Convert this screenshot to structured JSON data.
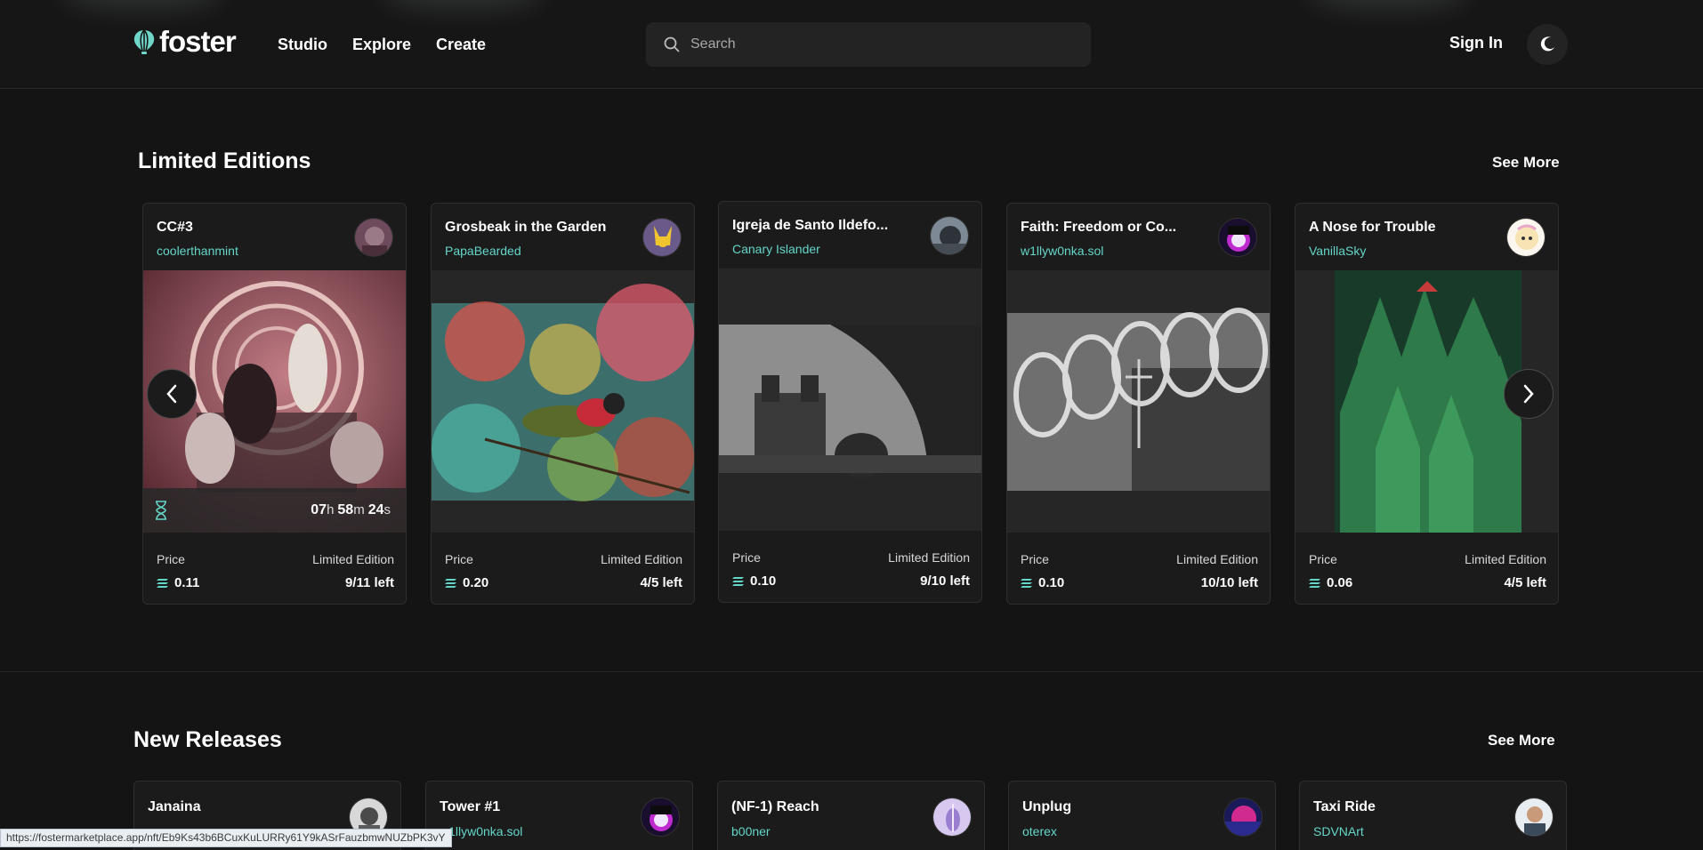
{
  "header": {
    "logo_text": "foster",
    "nav": [
      {
        "label": "Studio"
      },
      {
        "label": "Explore"
      },
      {
        "label": "Create"
      }
    ],
    "search_placeholder": "Search",
    "sign_in": "Sign In"
  },
  "limited_editions": {
    "title": "Limited Editions",
    "see_more": "See More",
    "price_label": "Price",
    "edition_label": "Limited Edition",
    "cards": [
      {
        "title": "CC#3",
        "artist": "coolerthanmint",
        "price": "0.11",
        "left": "9/11 left",
        "timer": {
          "h": "07",
          "h_unit": "h",
          "m": "58",
          "m_unit": "m",
          "s": "24",
          "s_unit": "s"
        }
      },
      {
        "title": "Grosbeak in the Garden",
        "artist": "PapaBearded",
        "price": "0.20",
        "left": "4/5 left"
      },
      {
        "title": "Igreja de Santo Ildefo...",
        "artist": "Canary Islander",
        "price": "0.10",
        "left": "9/10 left"
      },
      {
        "title": "Faith: Freedom or Co...",
        "artist": "w1llyw0nka.sol",
        "price": "0.10",
        "left": "10/10 left"
      },
      {
        "title": "A Nose for Trouble",
        "artist": "VanillaSky",
        "price": "0.06",
        "left": "4/5 left"
      }
    ]
  },
  "new_releases": {
    "title": "New Releases",
    "see_more": "See More",
    "cards": [
      {
        "title": "Janaina",
        "artist": ""
      },
      {
        "title": "Tower #1",
        "artist": "w1llyw0nka.sol"
      },
      {
        "title": "(NF-1) Reach",
        "artist": "b00ner"
      },
      {
        "title": "Unplug",
        "artist": "oterex"
      },
      {
        "title": "Taxi Ride",
        "artist": "SDVNArt"
      }
    ]
  },
  "status_url": "https://fostermarketplace.app/nft/Eb9Ks43b6BCuxKuLURRy61Y9kASrFauzbmwNUZbPK3vY",
  "colors": {
    "accent": "#63d6c8",
    "background": "#141414",
    "card": "#1b1b1b"
  }
}
